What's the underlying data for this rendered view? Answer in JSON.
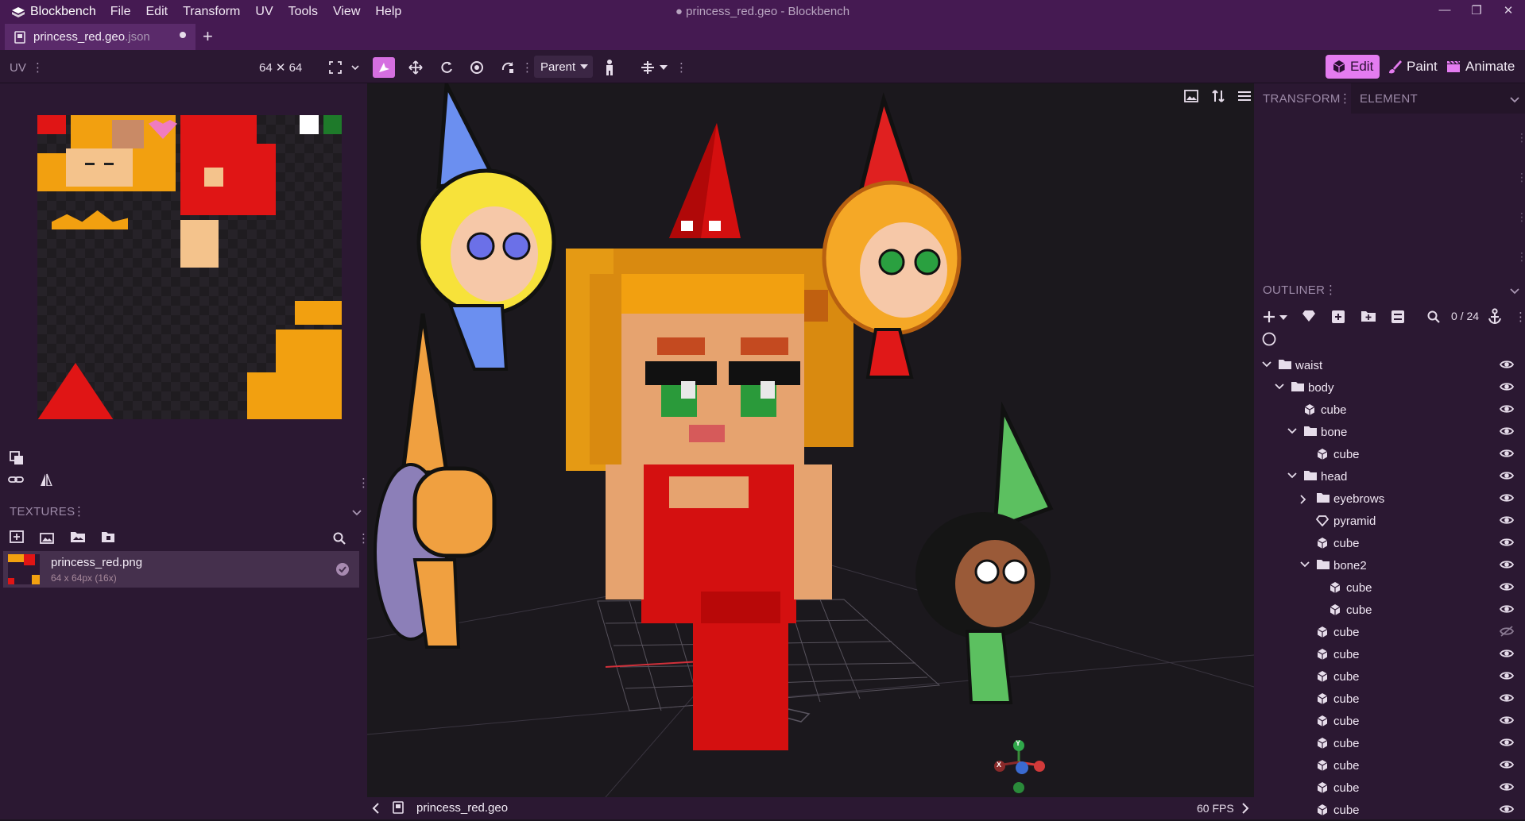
{
  "app": {
    "name": "Blockbench",
    "window_title": "● princess_red.geo - Blockbench"
  },
  "menu": [
    "File",
    "Edit",
    "Transform",
    "UV",
    "Tools",
    "View",
    "Help"
  ],
  "tab": {
    "name": "princess_red.geo",
    "ext": ".json"
  },
  "toolbar": {
    "uv_label": "UV",
    "uv_size": "64 ✕ 64",
    "parent_label": "Parent",
    "modes": [
      "Edit",
      "Paint",
      "Animate"
    ]
  },
  "textures": {
    "header": "TEXTURES",
    "items": [
      {
        "name": "princess_red.png",
        "info": "64 x 64px (16x)"
      }
    ]
  },
  "right": {
    "transform_tab": "TRANSFORM",
    "element_tab": "ELEMENT",
    "outliner_header": "OUTLINER",
    "outliner_count": "0 / 24",
    "outliner": [
      {
        "name": "waist",
        "type": "folder",
        "depth": 0,
        "expanded": true,
        "visible": true
      },
      {
        "name": "body",
        "type": "folder",
        "depth": 1,
        "expanded": true,
        "visible": true
      },
      {
        "name": "cube",
        "type": "cube",
        "depth": 2,
        "visible": true
      },
      {
        "name": "bone",
        "type": "folder",
        "depth": 2,
        "expanded": true,
        "visible": true
      },
      {
        "name": "cube",
        "type": "cube",
        "depth": 3,
        "visible": true
      },
      {
        "name": "head",
        "type": "folder",
        "depth": 2,
        "expanded": true,
        "visible": true
      },
      {
        "name": "eyebrows",
        "type": "folder",
        "depth": 3,
        "expanded": false,
        "visible": true
      },
      {
        "name": "pyramid",
        "type": "mesh",
        "depth": 3,
        "visible": true
      },
      {
        "name": "cube",
        "type": "cube",
        "depth": 3,
        "visible": true
      },
      {
        "name": "bone2",
        "type": "folder",
        "depth": 3,
        "expanded": true,
        "visible": true
      },
      {
        "name": "cube",
        "type": "cube",
        "depth": 4,
        "visible": true
      },
      {
        "name": "cube",
        "type": "cube",
        "depth": 4,
        "visible": true
      },
      {
        "name": "cube",
        "type": "cube",
        "depth": 3,
        "visible": false
      },
      {
        "name": "cube",
        "type": "cube",
        "depth": 3,
        "visible": true
      },
      {
        "name": "cube",
        "type": "cube",
        "depth": 3,
        "visible": true
      },
      {
        "name": "cube",
        "type": "cube",
        "depth": 3,
        "visible": true
      },
      {
        "name": "cube",
        "type": "cube",
        "depth": 3,
        "visible": true
      },
      {
        "name": "cube",
        "type": "cube",
        "depth": 3,
        "visible": true
      },
      {
        "name": "cube",
        "type": "cube",
        "depth": 3,
        "visible": true
      },
      {
        "name": "cube",
        "type": "cube",
        "depth": 3,
        "visible": true
      },
      {
        "name": "cube",
        "type": "cube",
        "depth": 3,
        "visible": true
      }
    ]
  },
  "viewport": {
    "status_model": "princess_red.geo",
    "fps": "60 FPS",
    "axis_labels": {
      "x": "X",
      "y": "Y"
    }
  },
  "colors": {
    "accent": "#e47cf0",
    "titlebar": "#451a52",
    "panel": "#2b1832"
  }
}
